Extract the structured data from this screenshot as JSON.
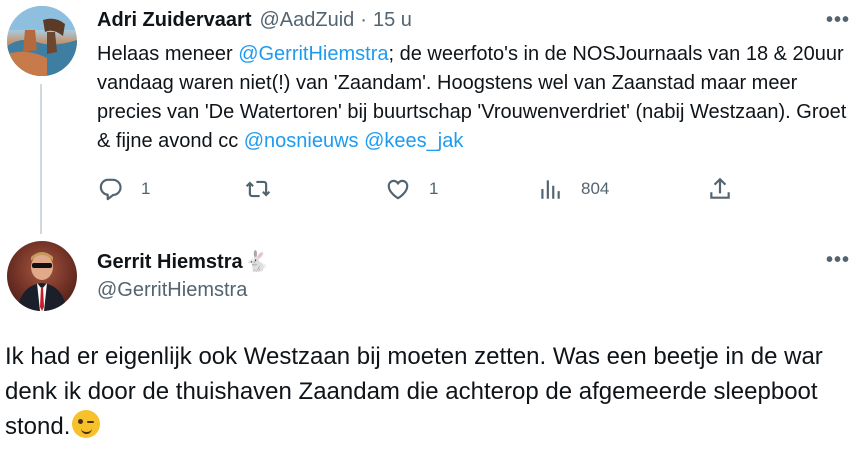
{
  "tweet1": {
    "name": "Adri Zuidervaart",
    "handle": "@AadZuid",
    "separator": "·",
    "time": "15 u",
    "more_label": "•••",
    "text": {
      "p1": "Helaas meneer ",
      "mention1": "@GerritHiemstra",
      "p2": "; de weerfoto's in de NOSJournaals van 18 & 20uur vandaag waren niet(!) van 'Zaandam'. Hoogstens wel van Zaanstad maar meer precies van 'De Watertoren' bij buurtschap 'Vrouwenverdriet' (nabij Westzaan). Groet & fijne avond cc ",
      "mention2": "@nosnieuws",
      "p3": " ",
      "mention3": "@kees_jak"
    },
    "actions": {
      "reply_count": "1",
      "retweet_count": "",
      "like_count": "1",
      "views_count": "804"
    }
  },
  "tweet2": {
    "name": "Gerrit Hiemstra",
    "name_emoji": "🐇",
    "handle": "@GerritHiemstra",
    "more_label": "•••",
    "text": "Ik had er eigenlijk ook Westzaan bij moeten zetten. Was een beetje in de war denk ik door de thuishaven Zaandam die achterop de afgemeerde sleepboot stond.",
    "emoji_name": "winking-face"
  },
  "colors": {
    "link": "#1d9bf0",
    "secondary_text": "#536471",
    "primary_text": "#0f1419",
    "thread_line": "#cfd9de"
  },
  "icons": [
    "reply-icon",
    "retweet-icon",
    "like-icon",
    "views-icon",
    "share-icon",
    "more-icon"
  ]
}
